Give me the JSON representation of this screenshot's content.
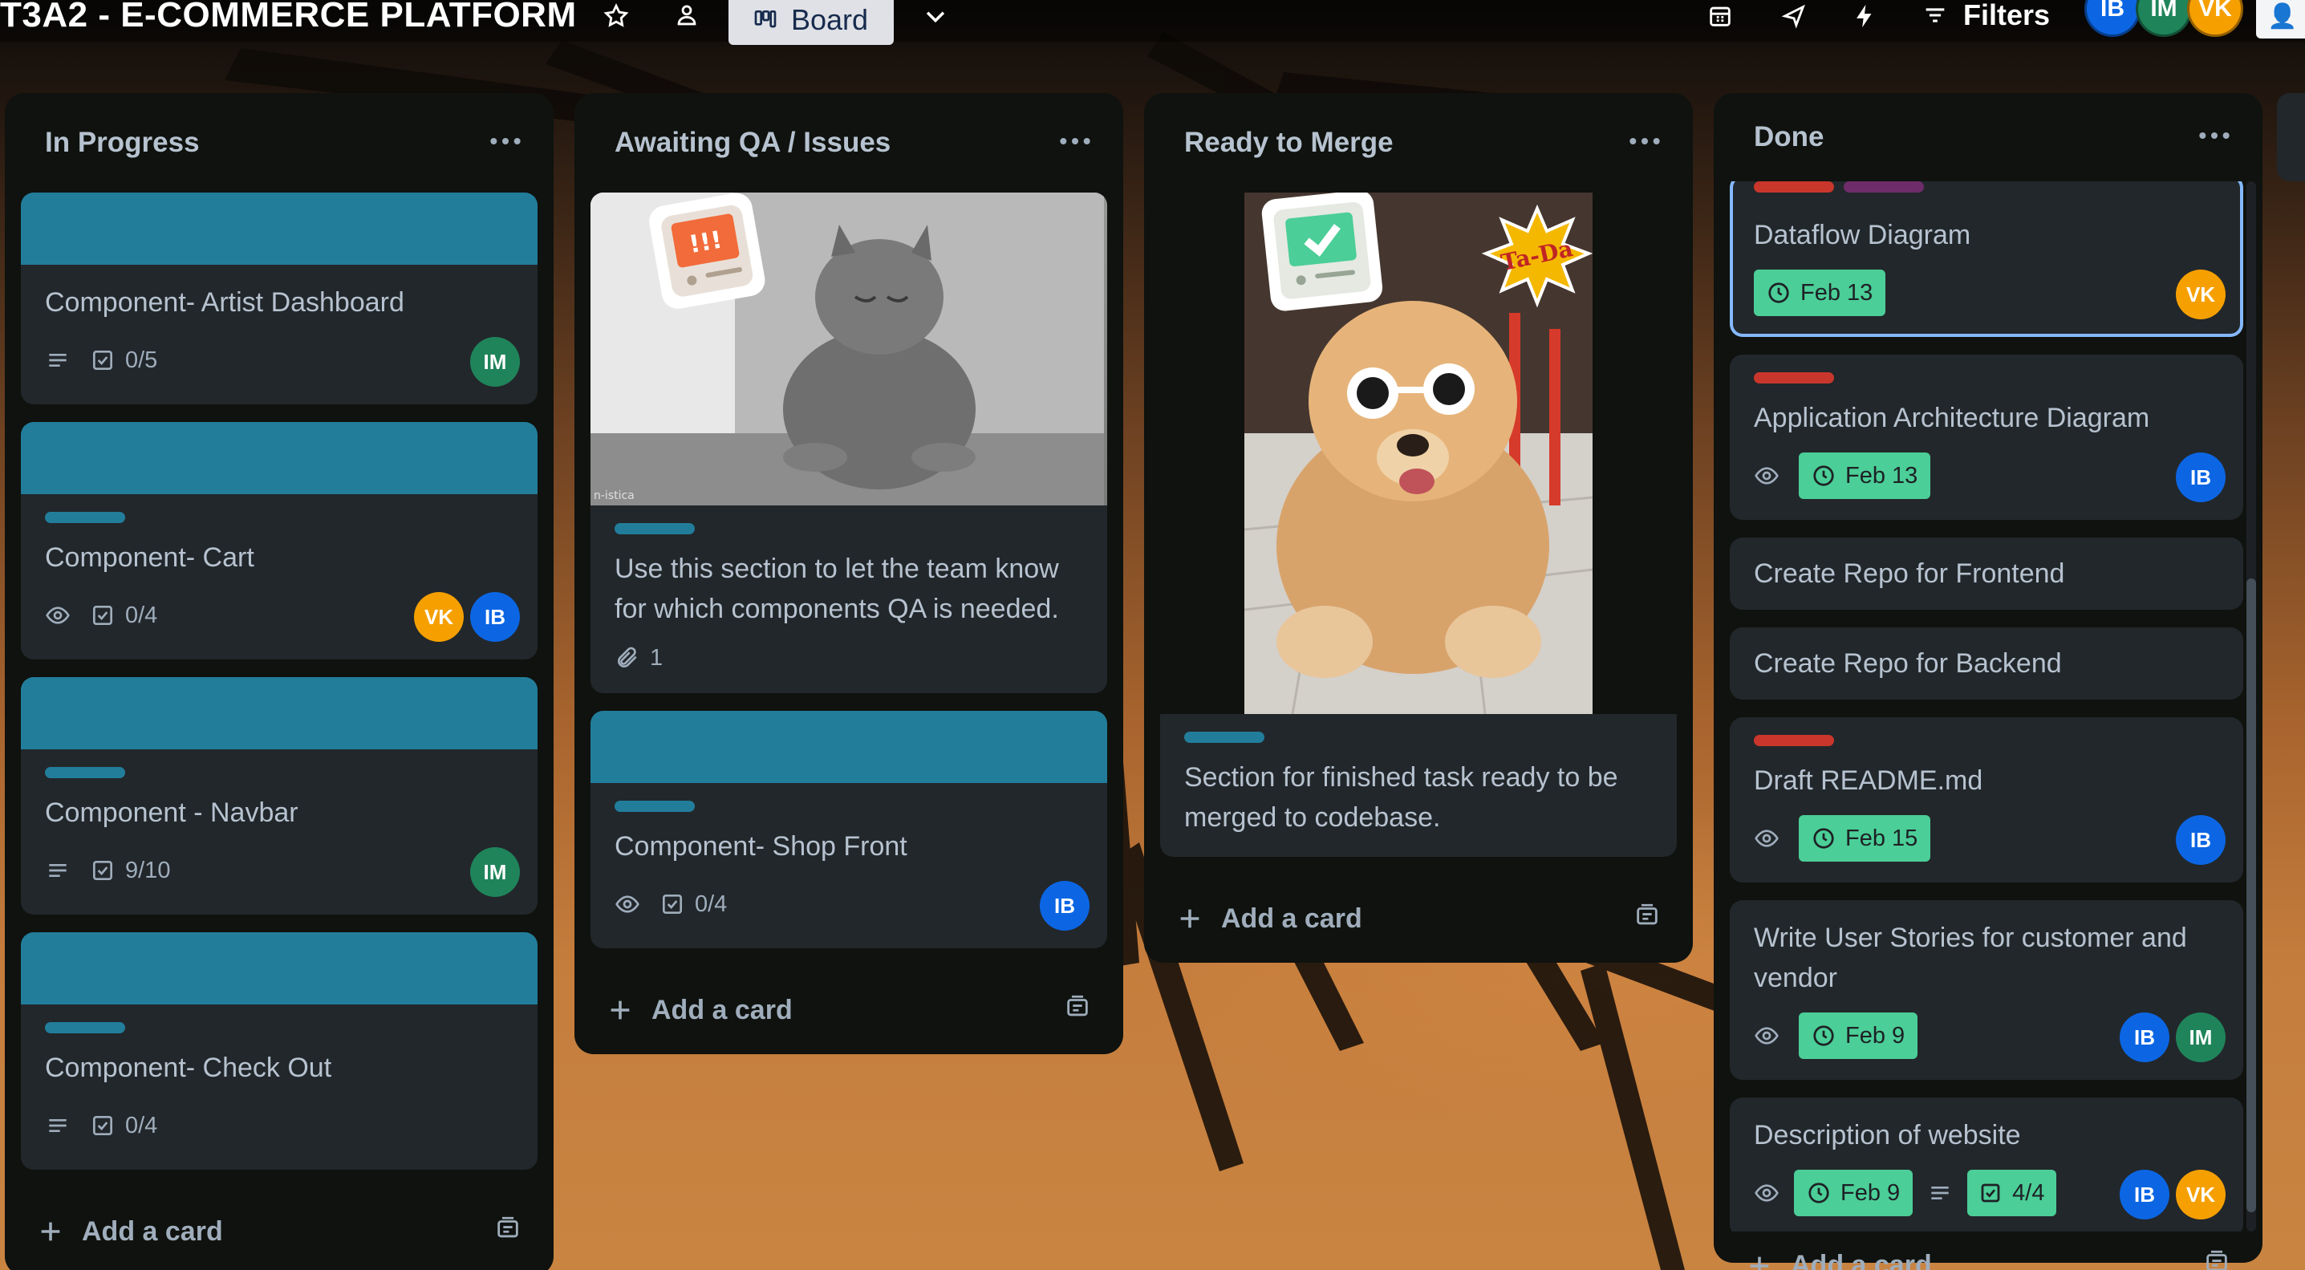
{
  "board": {
    "title": "T3A2 - E-COMMERCE PLATFORM",
    "view_label": "Board",
    "filters_label": "Filters",
    "members": [
      {
        "initials": "IB",
        "color": "#0c66e4"
      },
      {
        "initials": "IM",
        "color": "#1f845a"
      },
      {
        "initials": "VK",
        "color": "#f5a000"
      }
    ]
  },
  "lists": [
    {
      "title": "In Progress",
      "add_label": "Add a card",
      "cards": [
        {
          "title": "Component- Artist Dashboard",
          "checklist": "0/5",
          "members": [
            "IM"
          ]
        },
        {
          "title": "Component- Cart",
          "checklist": "0/4",
          "members": [
            "VK",
            "IB"
          ]
        },
        {
          "title": "Component - Navbar",
          "checklist": "9/10",
          "members": [
            "IM"
          ]
        },
        {
          "title": "Component- Check Out",
          "checklist": "0/4",
          "members": []
        }
      ]
    },
    {
      "title": "Awaiting QA / Issues",
      "add_label": "Add a card",
      "cards": [
        {
          "title": "Use this section to let the team know for which components QA is needed.",
          "attachments": "1",
          "image_text": "!!!",
          "watermark": "n-istica"
        },
        {
          "title": "Component- Shop Front",
          "checklist": "0/4",
          "members": [
            "IB"
          ]
        }
      ]
    },
    {
      "title": "Ready to Merge",
      "add_label": "Add a card",
      "cards": [
        {
          "title": "Section for finished task ready to be merged to codebase.",
          "sticker_text": "Ta-Da"
        }
      ]
    },
    {
      "title": "Done",
      "add_label": "Add a card",
      "cards": [
        {
          "title": "Dataflow Diagram",
          "date": "Feb 13",
          "members": [
            "VK"
          ]
        },
        {
          "title": "Application Architecture Diagram",
          "date": "Feb 13",
          "members": [
            "IB"
          ]
        },
        {
          "title": "Create Repo for Frontend"
        },
        {
          "title": "Create Repo for Backend"
        },
        {
          "title": "Draft README.md",
          "date": "Feb 15",
          "members": [
            "IB"
          ]
        },
        {
          "title": "Write User Stories for customer and vendor",
          "date": "Feb 9",
          "members": [
            "IB",
            "IM"
          ]
        },
        {
          "title": "Description of website",
          "date": "Feb 9",
          "checklist": "4/4",
          "members": [
            "IB",
            "VK"
          ]
        }
      ]
    }
  ],
  "colors": {
    "card_cover": "#227d9b",
    "label_red": "#c9372c",
    "date_badge": "#4bce97",
    "card_bg": "#22272b",
    "list_bg": "#0f120e"
  }
}
